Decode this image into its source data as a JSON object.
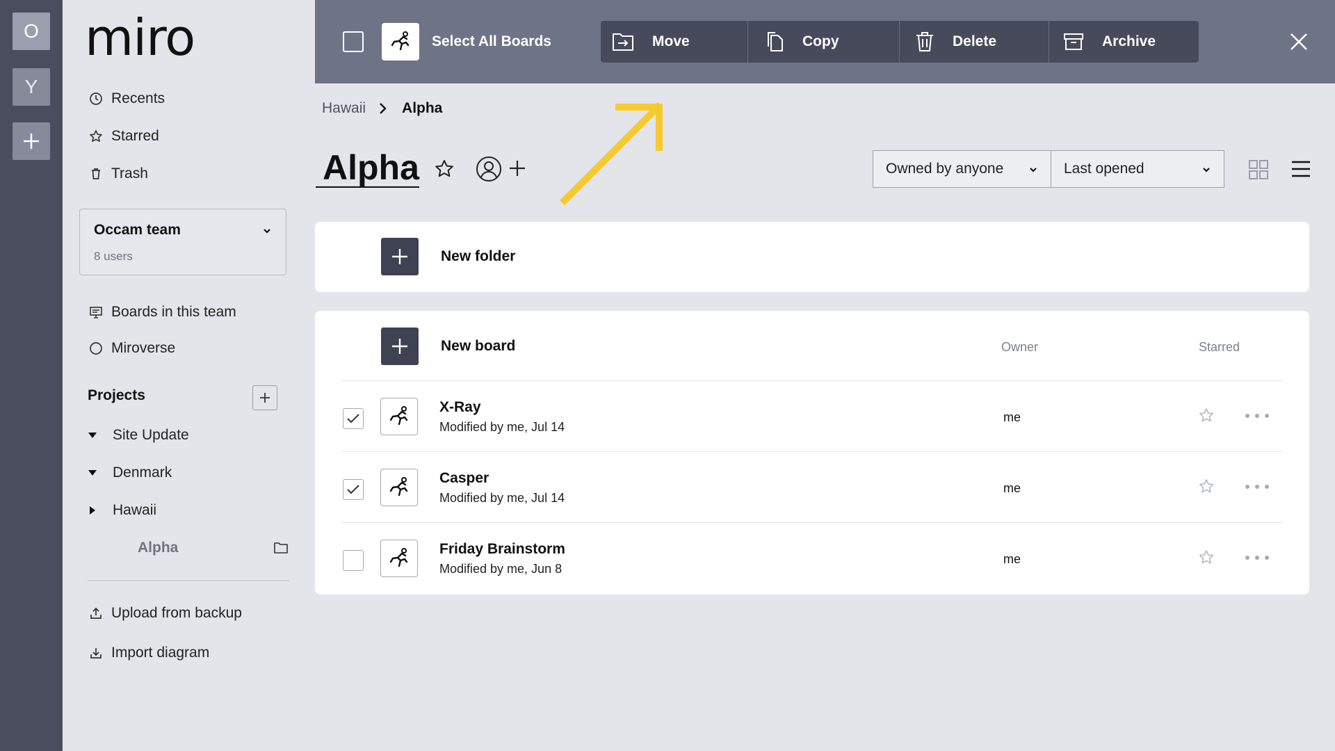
{
  "rail": {
    "items": [
      "O",
      "Y",
      "+"
    ]
  },
  "sidebar": {
    "logo": "miro",
    "nav": [
      {
        "label": "Recents",
        "icon": "clock-icon"
      },
      {
        "label": "Starred",
        "icon": "star-icon"
      },
      {
        "label": "Trash",
        "icon": "trash-icon"
      }
    ],
    "team": {
      "name": "Occam team",
      "users": "8 users"
    },
    "team_nav": [
      {
        "label": "Boards in this team",
        "icon": "presentation-board-icon"
      },
      {
        "label": "Miroverse",
        "icon": "circle-icon"
      }
    ],
    "projects_title": "Projects",
    "projects": [
      {
        "label": "Site Update",
        "state": "expanded"
      },
      {
        "label": "Denmark",
        "state": "expanded"
      },
      {
        "label": "Hawaii",
        "state": "collapsed"
      },
      {
        "label": "Alpha",
        "state": "child"
      }
    ],
    "footer": [
      {
        "label": "Upload from backup",
        "icon": "upload-icon"
      },
      {
        "label": "Import diagram",
        "icon": "download-icon"
      }
    ]
  },
  "topbar": {
    "select_all": "Select All Boards",
    "actions": [
      {
        "label": "Move",
        "icon": "move-icon"
      },
      {
        "label": "Copy",
        "icon": "copy-icon"
      },
      {
        "label": "Delete",
        "icon": "trash-icon"
      },
      {
        "label": "Archive",
        "icon": "archive-icon"
      }
    ]
  },
  "breadcrumb": {
    "parent": "Hawaii",
    "current": "Alpha"
  },
  "page_title": "Alpha",
  "filters": {
    "owner": "Owned by anyone",
    "sort": "Last opened"
  },
  "new_folder": "New folder",
  "new_board": "New board",
  "columns": {
    "owner": "Owner",
    "starred": "Starred"
  },
  "boards": [
    {
      "name": "X-Ray",
      "meta": "Modified by me, Jul 14",
      "owner": "me",
      "checked": true
    },
    {
      "name": "Casper",
      "meta": "Modified by me, Jul 14",
      "owner": "me",
      "checked": true
    },
    {
      "name": "Friday Brainstorm",
      "meta": "Modified by me, Jun 8",
      "owner": "me",
      "checked": false
    }
  ],
  "colors": {
    "rail": "#4a4d5e",
    "topbar": "#6f7386",
    "action_group": "#464a5b",
    "arrow": "#f7c92e"
  }
}
